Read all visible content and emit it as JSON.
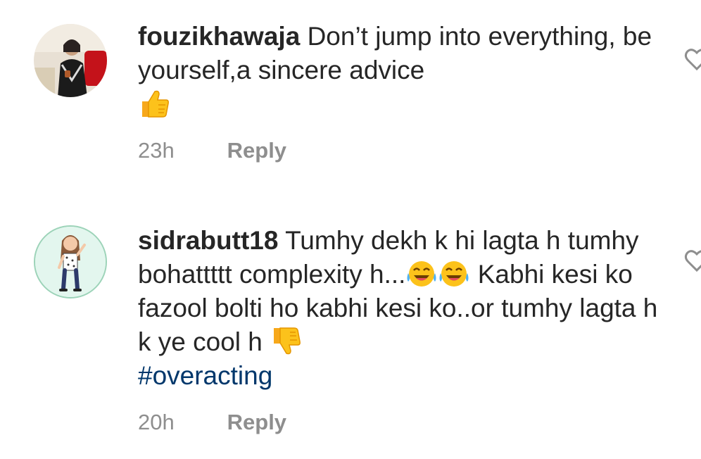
{
  "comments": [
    {
      "username": "fouzikhawaja",
      "text": "Don’t jump into everything, be yourself,a sincere advice",
      "emoji_end": "thumbs-up",
      "time": "23h",
      "reply_label": "Reply"
    },
    {
      "username": "sidrabutt18",
      "text_part1": "Tumhy dekh k hi lagta h tumhy bohattttt complexity h...",
      "text_part2": "Kabhi kesi ko fazool bolti ho kabhi kesi ko..or tumhy lagta h k ye cool h",
      "hashtag": "#overacting",
      "emojis": [
        "tears-of-joy",
        "tears-of-joy",
        "thumbs-down"
      ],
      "time": "20h",
      "reply_label": "Reply"
    }
  ],
  "colors": {
    "text": "#262626",
    "meta": "#8e8e8e",
    "hashtag": "#00376b",
    "emoji": "#fcc21b"
  }
}
